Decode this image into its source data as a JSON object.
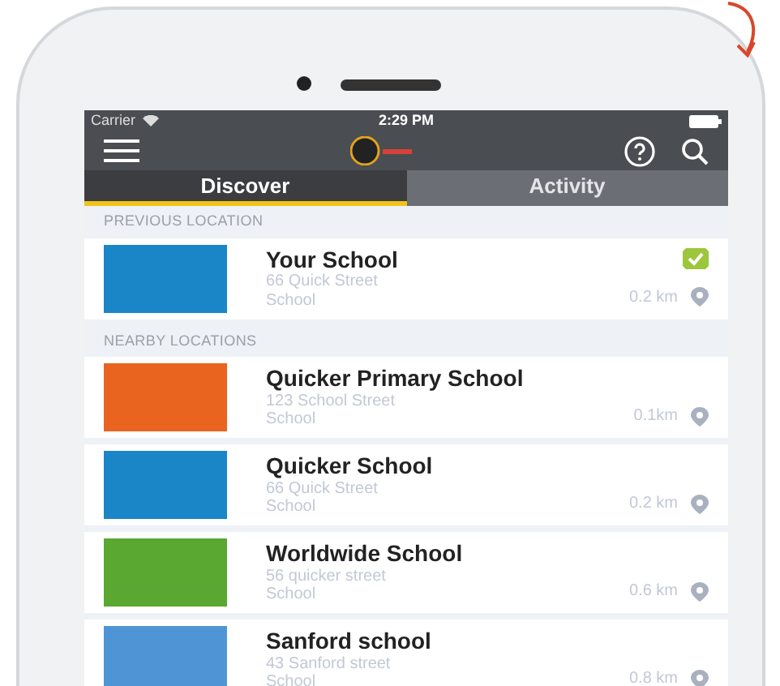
{
  "status_bar": {
    "carrier": "Carrier",
    "time": "2:29 PM"
  },
  "tabs": [
    {
      "label": "Discover",
      "selected": true
    },
    {
      "label": "Activity",
      "selected": false
    }
  ],
  "sections": [
    {
      "title": "PREVIOUS LOCATION",
      "items": [
        {
          "name": "Your School",
          "address": "66 Quick Street",
          "type": "School",
          "distance": "0.2 km",
          "color": "#1a86c8",
          "checked": true
        }
      ]
    },
    {
      "title": "NEARBY LOCATIONS",
      "items": [
        {
          "name": "Quicker Primary School",
          "address": "123 School Street",
          "type": "School",
          "distance": "0.1km",
          "color": "#e8641f",
          "checked": false
        },
        {
          "name": "Quicker School",
          "address": "66 Quick Street",
          "type": "School",
          "distance": "0.2 km",
          "color": "#1a86c8",
          "checked": false
        },
        {
          "name": "Worldwide School",
          "address": "56 quicker street",
          "type": "School",
          "distance": "0.6 km",
          "color": "#5aa832",
          "checked": false
        },
        {
          "name": "Sanford school",
          "address": "43 Sanford street",
          "type": "School",
          "distance": "0.8 km",
          "color": "#4f95d6",
          "checked": false
        }
      ]
    }
  ]
}
